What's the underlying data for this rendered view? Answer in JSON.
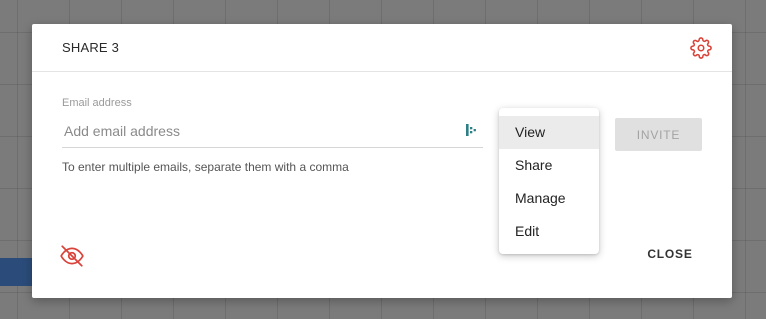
{
  "modal": {
    "title": "SHARE 3"
  },
  "email": {
    "label": "Email address",
    "placeholder": "Add email address",
    "value": "",
    "helper": "To enter multiple emails, separate them with a comma"
  },
  "actions": {
    "invite_label": "INVITE",
    "close_label": "CLOSE"
  },
  "permission_menu": {
    "items": [
      {
        "label": "View",
        "selected": true
      },
      {
        "label": "Share",
        "selected": false
      },
      {
        "label": "Manage",
        "selected": false
      },
      {
        "label": "Edit",
        "selected": false
      }
    ]
  },
  "icons": {
    "settings": "gear-icon",
    "visibility": "eye-off-icon",
    "input_addon": "contact-picker-icon"
  },
  "colors": {
    "accent_red": "#d9443a",
    "addon_teal": "#2d7f86",
    "disabled_button_bg": "#e0e0e0",
    "disabled_button_text": "#a3a3a3",
    "menu_selected_bg": "#ebebeb",
    "overlay": "#7b7b7b"
  }
}
